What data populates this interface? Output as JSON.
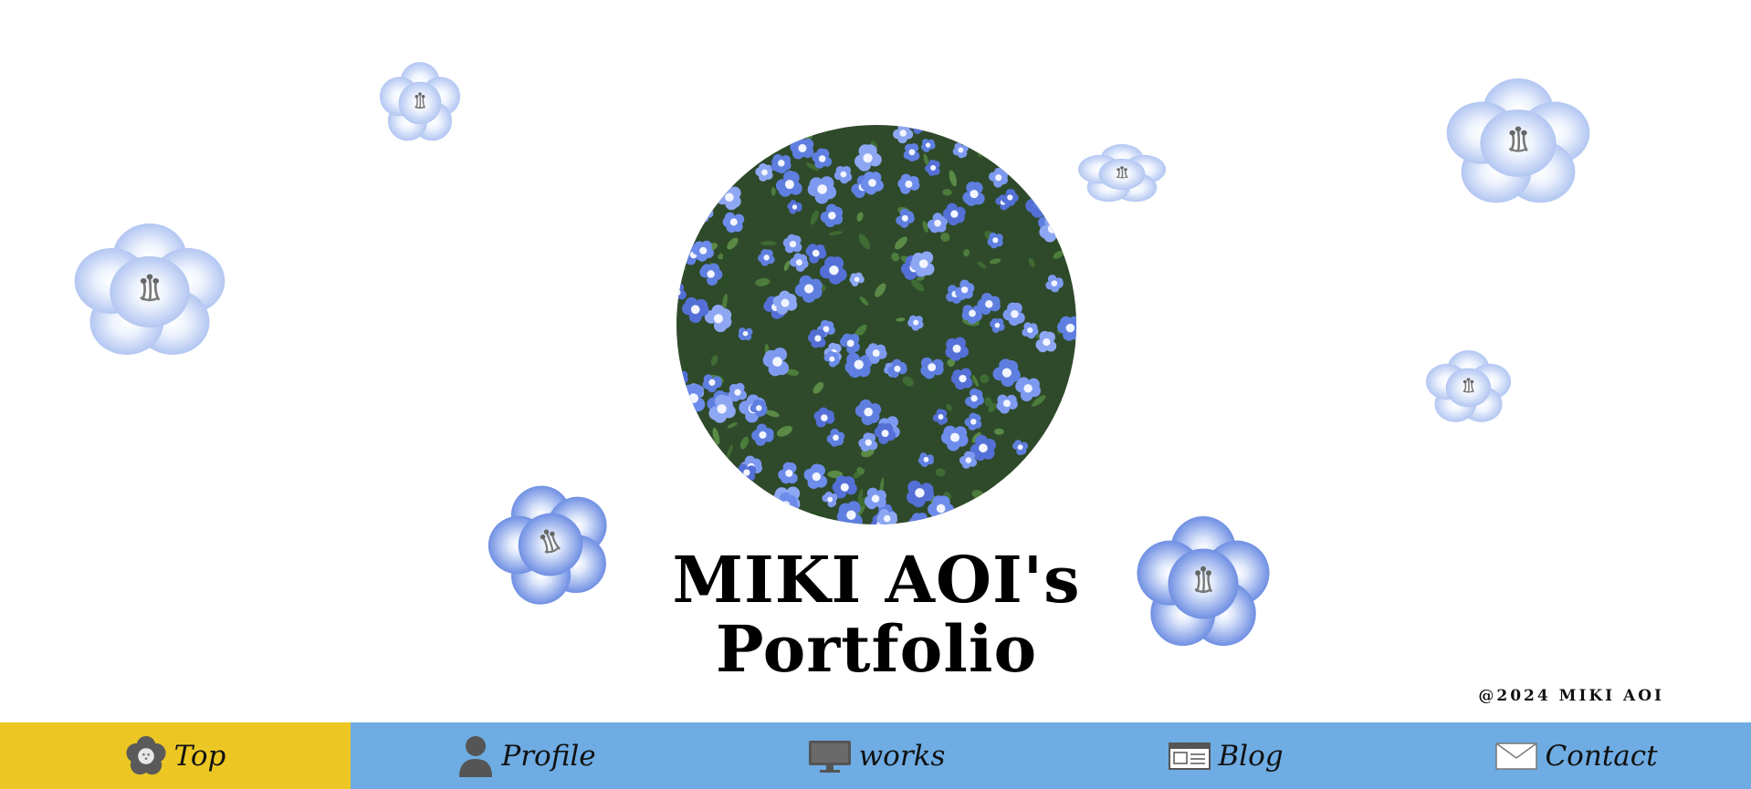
{
  "site": {
    "title_line1": "MIKI AOI's",
    "title_line2": "Portfolio",
    "copyright": "@2024 MIKI AOI"
  },
  "hero": {
    "image_alt": "nemophila-field-photo"
  },
  "colors": {
    "nav_bg": "#6eace3",
    "nav_active": "#ecc723",
    "flower_light": "#b9cdf4",
    "flower_dark": "#6f8fe3"
  },
  "nav": {
    "items": [
      {
        "label": "Top",
        "icon": "flower-icon",
        "active": true
      },
      {
        "label": "Profile",
        "icon": "person-icon",
        "active": false
      },
      {
        "label": "works",
        "icon": "monitor-icon",
        "active": false
      },
      {
        "label": "Blog",
        "icon": "newspaper-icon",
        "active": false
      },
      {
        "label": "Contact",
        "icon": "envelope-icon",
        "active": false
      }
    ]
  }
}
